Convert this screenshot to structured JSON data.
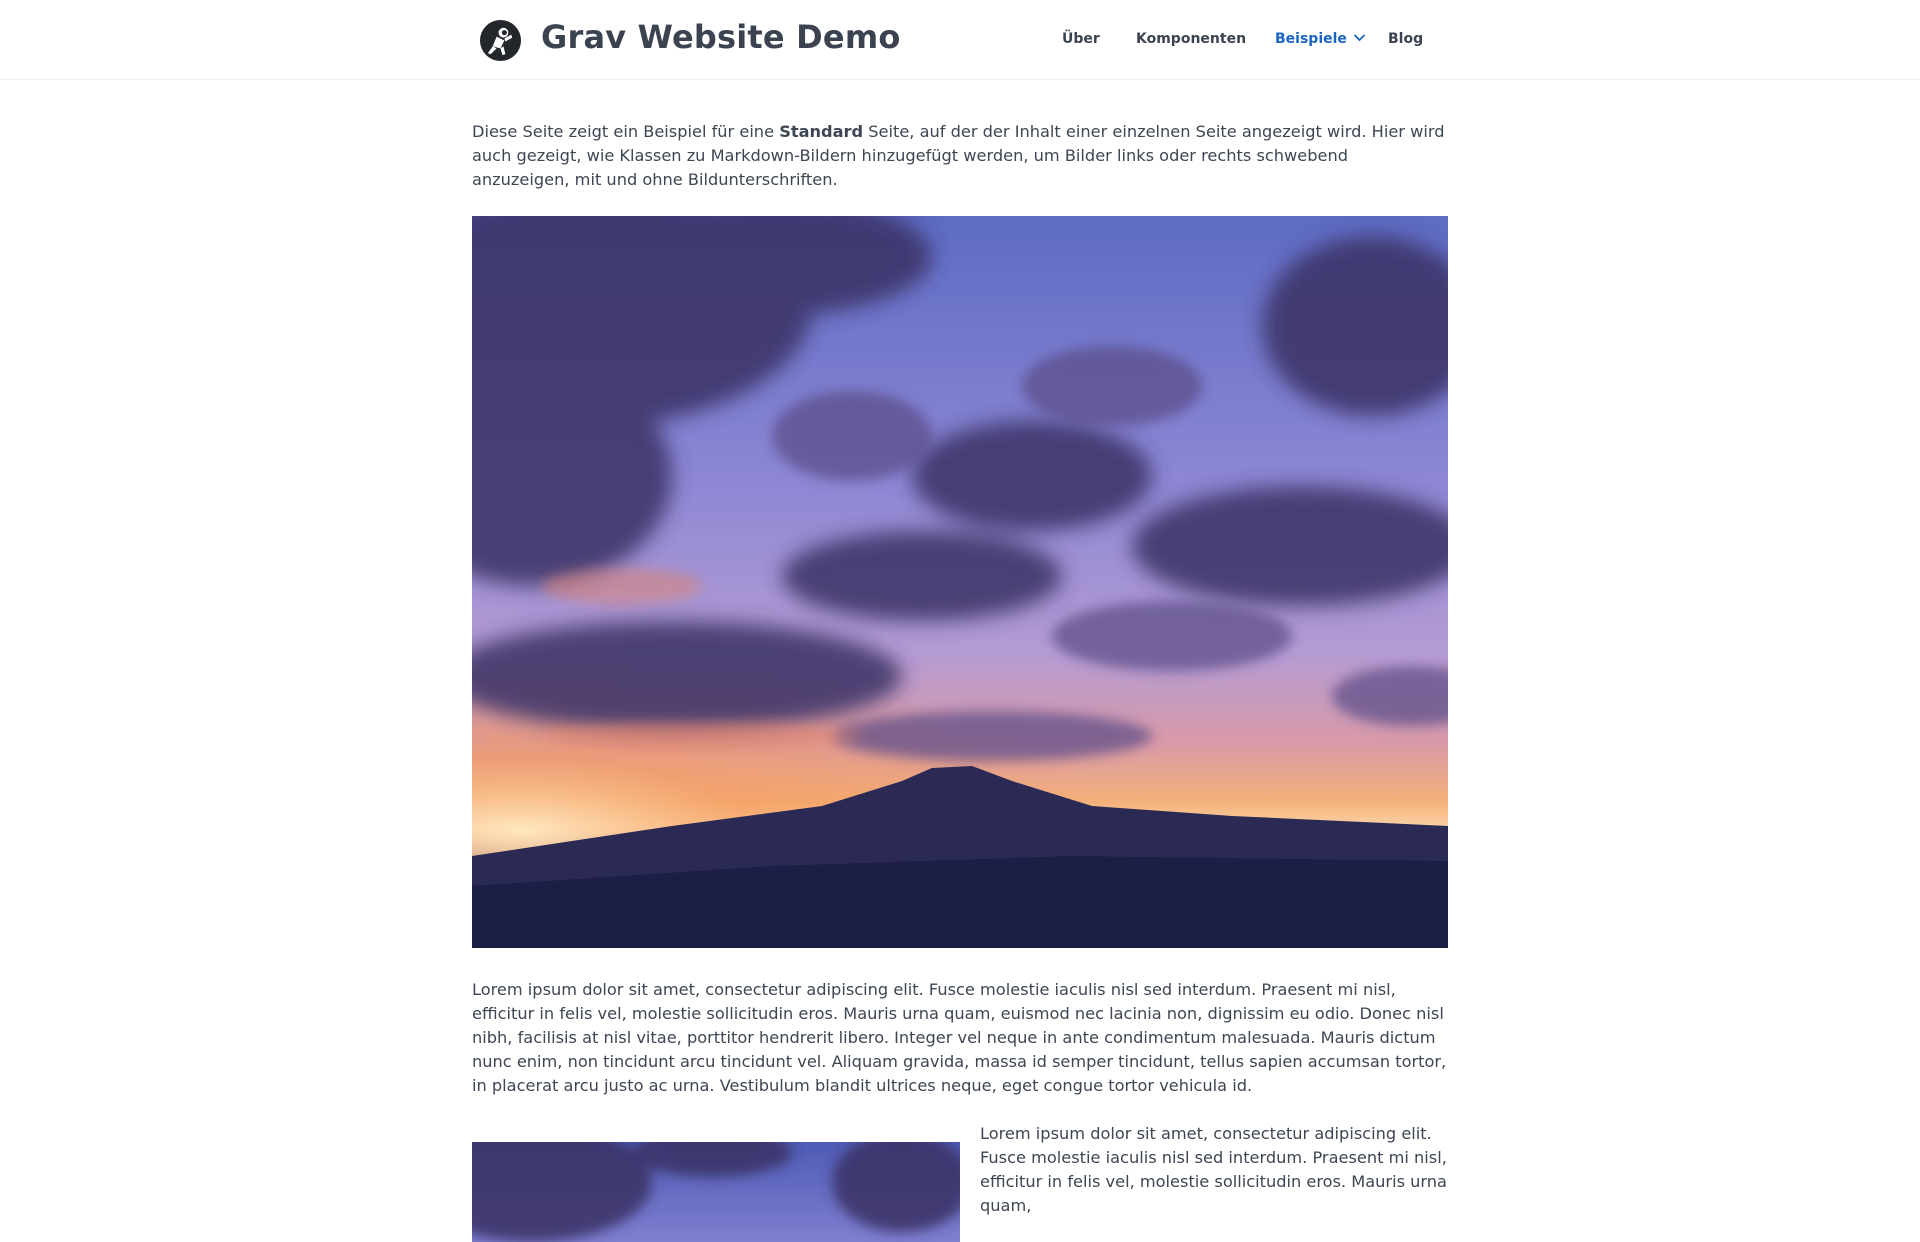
{
  "site": {
    "title": "Grav Website Demo",
    "logo_icon": "astronaut-logo-icon"
  },
  "nav": {
    "items": [
      {
        "label": "Über",
        "active": false
      },
      {
        "label": "Komponenten",
        "active": false
      },
      {
        "label": "Beispiele",
        "active": true,
        "has_dropdown": true
      },
      {
        "label": "Blog",
        "active": false
      }
    ]
  },
  "content": {
    "intro_before": "Diese Seite zeigt ein Beispiel für eine ",
    "intro_bold": "Standard",
    "intro_after": " Seite, auf der der Inhalt einer einzelnen Seite angezeigt wird. Hier wird auch gezeigt, wie Klassen zu Markdown-Bildern hinzugefügt werden, um Bilder links oder rechts schwebend anzuzeigen, mit und ohne Bildunterschriften.",
    "paragraph_2": "Lorem ipsum dolor sit amet, consectetur adipiscing elit. Fusce molestie iaculis nisl sed interdum. Praesent mi nisl, efficitur in felis vel, molestie sollicitudin eros. Mauris urna quam, euismod nec lacinia non, dignissim eu odio. Donec nisl nibh, facilisis at nisl vitae, porttitor hendrerit libero. Integer vel neque in ante condimentum malesuada. Mauris dictum nunc enim, non tincidunt arcu tincidunt vel. Aliquam gravida, massa id semper tincidunt, tellus sapien accumsan tortor, in placerat arcu justo ac urna. Vestibulum blandit ultrices neque, eget congue tortor vehicula id.",
    "paragraph_3": "Lorem ipsum dolor sit amet, consectetur adipiscing elit. Fusce molestie iaculis nisl sed interdum. Praesent mi nisl, efficitur in felis vel, molestie sollicitudin eros. Mauris urna quam,"
  },
  "colors": {
    "accent": "#1a64c4",
    "text": "#3e4654",
    "sky_top": "#6f7fd0",
    "sky_purple": "#9b7fc8",
    "horizon_orange": "#f4a36a",
    "horizon_light": "#fde0b4",
    "mountain": "#2b2a55",
    "ground": "#1b1f45"
  }
}
